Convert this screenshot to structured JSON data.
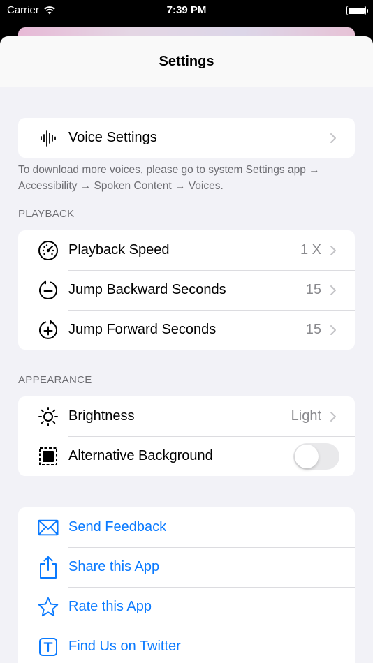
{
  "status_bar": {
    "carrier": "Carrier",
    "time": "7:39 PM"
  },
  "nav": {
    "title": "Settings"
  },
  "voice_group": {
    "voice_settings": {
      "label": "Voice Settings",
      "icon": "waveform-icon"
    }
  },
  "voice_footer": "To download more voices, please go to system Settings app → Accessibility → Spoken Content → Voices.",
  "playback": {
    "header": "PLAYBACK",
    "speed": {
      "label": "Playback Speed",
      "value": "1 X",
      "icon": "speedometer-icon"
    },
    "backward": {
      "label": "Jump Backward Seconds",
      "value": "15",
      "icon": "jump-backward-icon"
    },
    "forward": {
      "label": "Jump Forward Seconds",
      "value": "15",
      "icon": "jump-forward-icon"
    }
  },
  "appearance": {
    "header": "APPEARANCE",
    "brightness": {
      "label": "Brightness",
      "value": "Light",
      "icon": "sun-icon"
    },
    "alt_background": {
      "label": "Alternative Background",
      "enabled": false,
      "icon": "square-frame-icon"
    }
  },
  "about": {
    "feedback": {
      "label": "Send Feedback",
      "icon": "envelope-icon"
    },
    "share": {
      "label": "Share this App",
      "icon": "share-icon"
    },
    "rate": {
      "label": "Rate this App",
      "icon": "star-icon"
    },
    "twitter": {
      "label": "Find Us on Twitter",
      "icon": "twitter-t-icon"
    }
  },
  "colors": {
    "accent": "#0a7aff",
    "secondary_text": "#8a8a8e",
    "background": "#f2f2f7"
  }
}
